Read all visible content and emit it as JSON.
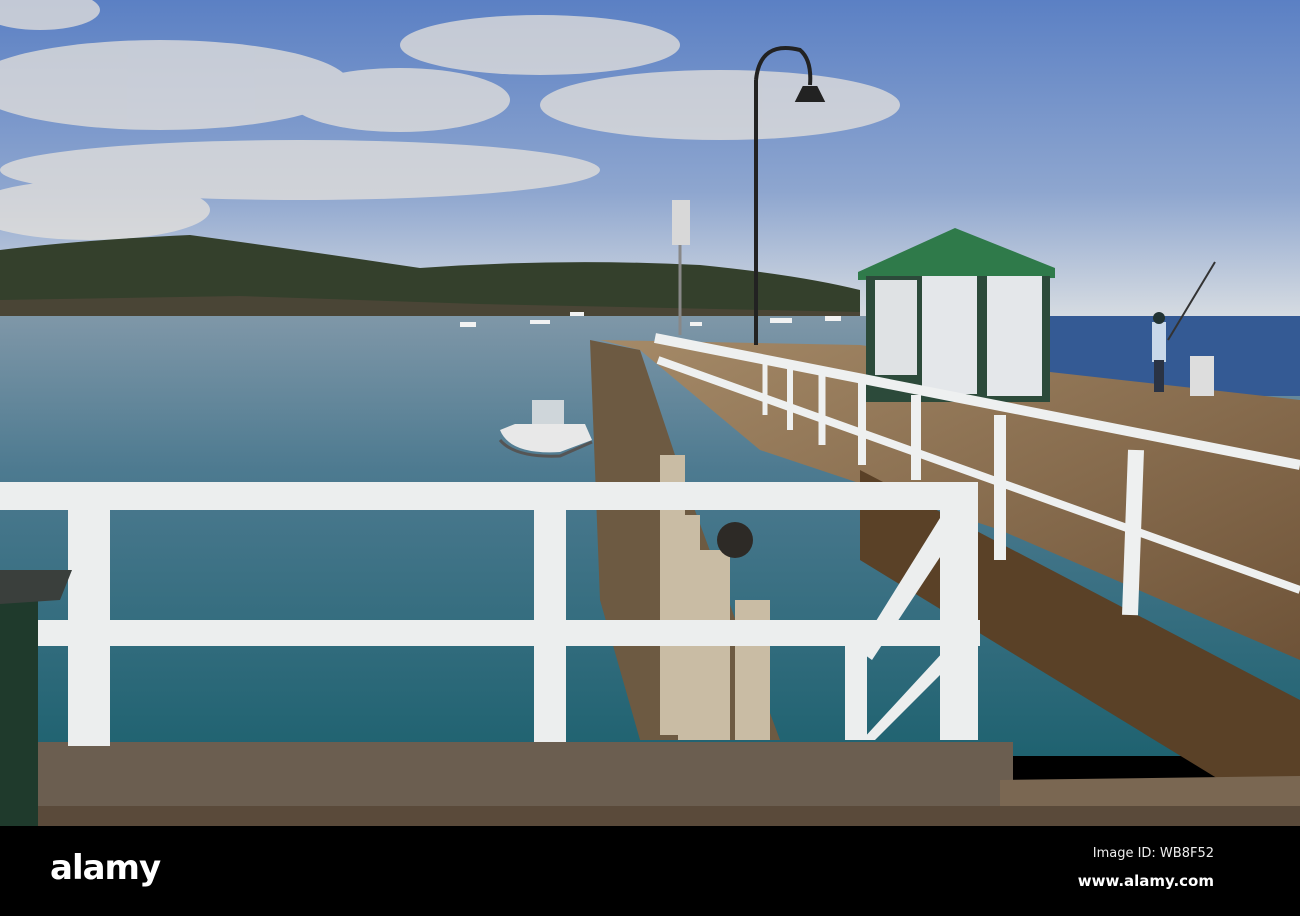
{
  "watermark": {
    "logo": "alamy",
    "image_id": "Image ID: WB8F52",
    "url": "www.alamy.com"
  },
  "colors": {
    "sky_top": "#5b80c4",
    "sky_horizon": "#d8dde2",
    "water": "#3f6f86",
    "deck": "#8a6f50",
    "rail": "#eef0f0",
    "shed_roof": "#2f7a4a"
  }
}
